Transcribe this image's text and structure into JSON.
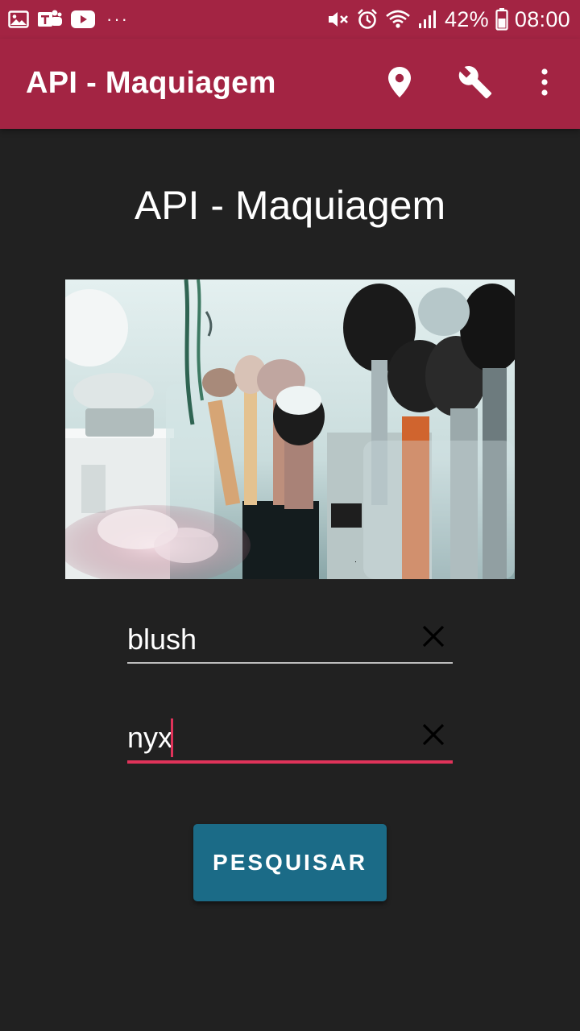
{
  "status_bar": {
    "battery_percent": "42%",
    "time": "08:00",
    "overflow": "···",
    "icons": [
      "gallery-icon",
      "teams-icon",
      "youtube-icon",
      "mute-icon",
      "alarm-icon",
      "wifi-icon",
      "signal-icon",
      "battery-icon"
    ]
  },
  "app_bar": {
    "title": "API - Maquiagem",
    "actions": [
      "location-pin-icon",
      "wrench-icon",
      "more-vert-icon"
    ],
    "color": "#a32443"
  },
  "main": {
    "title": "API - Maquiagem",
    "image": "makeup-brushes-photo",
    "product_type_value": "blush",
    "brand_value": "nyx",
    "search_label": "PESQUISAR"
  },
  "colors": {
    "background": "#212121",
    "accent": "#e0335a",
    "button": "#1b6b87"
  }
}
